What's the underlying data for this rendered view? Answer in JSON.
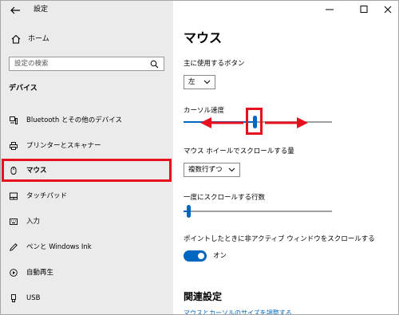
{
  "window": {
    "title": "設定"
  },
  "sidebar": {
    "home_label": "ホーム",
    "search_placeholder": "設定の検索",
    "section_label": "デバイス",
    "items": [
      {
        "label": "Bluetooth とその他のデバイス",
        "icon": "bluetooth-device-icon"
      },
      {
        "label": "プリンターとスキャナー",
        "icon": "printer-icon"
      },
      {
        "label": "マウス",
        "icon": "mouse-icon",
        "selected": true
      },
      {
        "label": "タッチパッド",
        "icon": "touchpad-icon"
      },
      {
        "label": "入力",
        "icon": "keyboard-icon"
      },
      {
        "label": "ペンと Windows Ink",
        "icon": "pen-icon"
      },
      {
        "label": "自動再生",
        "icon": "autoplay-icon"
      },
      {
        "label": "USB",
        "icon": "usb-icon"
      }
    ]
  },
  "main": {
    "title": "マウス",
    "primary_button": {
      "label": "主に使用するボタン",
      "value": "左"
    },
    "cursor_speed": {
      "label": "カーソル速度",
      "value_fraction": 0.48
    },
    "wheel_scroll": {
      "label": "マウス ホイールでスクロールする量",
      "value": "複数行ずつ"
    },
    "lines_to_scroll": {
      "label": "一度にスクロールする行数",
      "value_fraction": 0.03
    },
    "inactive_scroll": {
      "label": "ポイントしたときに非アクティブ ウィンドウをスクロールする",
      "state": "オン",
      "on": true
    },
    "related": {
      "heading": "関連設定",
      "link": "マウスとカーソルのサイズを調整する"
    }
  },
  "colors": {
    "accent": "#0067c0",
    "highlight": "#e8101f",
    "sidebar_bg": "#ebebeb"
  }
}
